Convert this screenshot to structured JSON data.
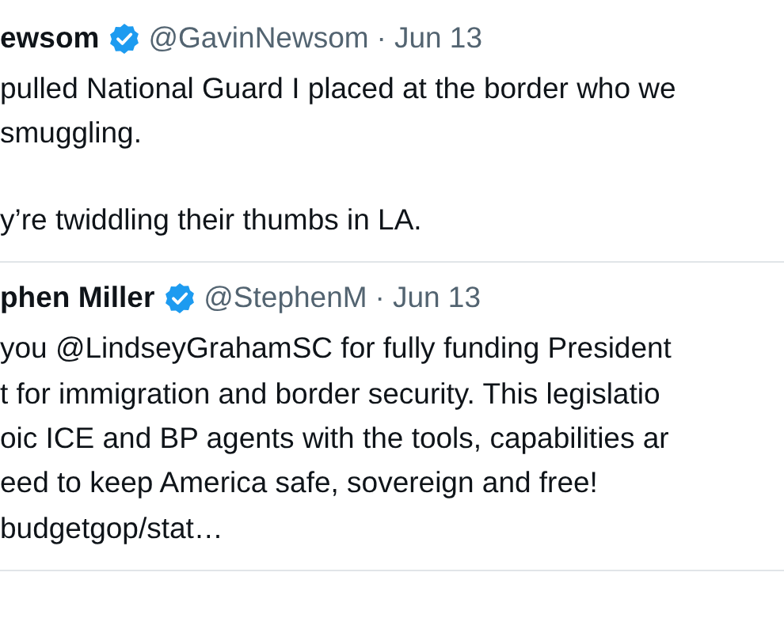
{
  "tweets": [
    {
      "name": "ewsom",
      "verified": true,
      "handle": "@GavinNewsom",
      "separator": "·",
      "date": "Jun 13",
      "paragraphs": [
        [
          "pulled National Guard I placed at the border who we",
          "smuggling."
        ],
        [
          "y’re twiddling their thumbs in LA."
        ]
      ]
    },
    {
      "name": "phen Miller",
      "verified": true,
      "handle": "@StephenM",
      "separator": "·",
      "date": "Jun 13",
      "paragraphs": [
        [
          "you @LindseyGrahamSC for fully funding President",
          "t for immigration and border security. This legislatio",
          "oic ICE and BP agents with the tools, capabilities ar",
          "eed to keep America safe, sovereign and free!",
          "budgetgop/stat…"
        ]
      ]
    }
  ]
}
